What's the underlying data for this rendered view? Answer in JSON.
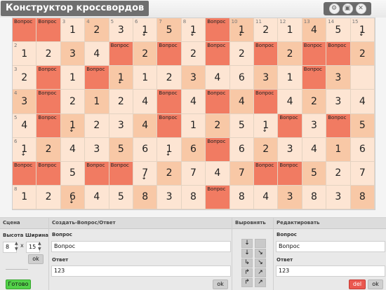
{
  "app": {
    "title": "Конструктор кроссвордов"
  },
  "window_buttons": [
    {
      "icon": "settings-icon"
    },
    {
      "icon": "document-icon"
    },
    {
      "icon": "close-icon"
    }
  ],
  "grid": {
    "rows": [
      [
        "Вопрос",
        "Вопрос",
        "1",
        "2",
        "3",
        "1",
        "5",
        "1",
        "Вопрос",
        "1",
        "2",
        "1",
        "4",
        "5",
        "1"
      ],
      [
        "1",
        "2",
        "3",
        "4",
        "Вопрос",
        "2",
        "Вопрос",
        "2",
        "Вопрос",
        "2",
        "Вопрос",
        "2",
        "Вопрос",
        "Вопрос",
        "2"
      ],
      [
        "2",
        "Вопрос",
        "1",
        "Вопрос",
        "1",
        "1",
        "2",
        "3",
        "4",
        "6",
        "3",
        "1",
        "Вопрос",
        "3",
        ""
      ],
      [
        "3",
        "Вопрос",
        "2",
        "1",
        "2",
        "4",
        "Вопрос",
        "4",
        "Вопрос",
        "4",
        "Вопрос",
        "4",
        "2",
        "3",
        "4"
      ],
      [
        "4",
        "Вопрос",
        "1",
        "2",
        "3",
        "4",
        "Вопрос",
        "1",
        "2",
        "5",
        "1",
        "Вопрос",
        "3",
        "Вопрос",
        "5"
      ],
      [
        "1",
        "2",
        "4",
        "3",
        "5",
        "6",
        "1",
        "6",
        "Вопрос",
        "6",
        "2",
        "3",
        "4",
        "1",
        "6"
      ],
      [
        "Вопрос",
        "Вопрос",
        "5",
        "Вопрос",
        "Вопрос",
        "7",
        "2",
        "7",
        "4",
        "7",
        "Вопрос",
        "Вопрос",
        "5",
        "2",
        "7"
      ],
      [
        "1",
        "2",
        "6",
        "4",
        "5",
        "8",
        "3",
        "8",
        "Вопрос",
        "8",
        "4",
        "3",
        "8",
        "3",
        "8"
      ]
    ],
    "col_numbers": [
      "",
      "",
      "3",
      "4",
      "5",
      "6",
      "7",
      "8",
      "9",
      "10",
      "11",
      "12",
      "13",
      "14",
      "15"
    ],
    "row_numbers": [
      "",
      "2",
      "3",
      "4",
      "5",
      "6",
      "7",
      "8"
    ]
  },
  "panel": {
    "scene": {
      "header": "Сцена",
      "height_label": "Высота",
      "width_label": "Ширина",
      "height_value": "8",
      "width_value": "15",
      "times": "x",
      "ok_label": "ok",
      "done_label": "Готово"
    },
    "create": {
      "header": "Создать-Вопрос/Ответ",
      "question_label": "Вопрос",
      "question_value": "Вопрос",
      "answer_label": "Ответ",
      "answer_value": "123",
      "ok_label": "ok"
    },
    "align": {
      "header": "Выровнять",
      "buttons": [
        "↓",
        "",
        "↓",
        "↘",
        "↳",
        "↘",
        "↱",
        "↗",
        "↱",
        "↗"
      ]
    },
    "edit": {
      "header": "Редактировать",
      "question_label": "Вопрос",
      "question_value": "Вопрос",
      "answer_label": "Ответ",
      "answer_value": "123",
      "del_label": "del",
      "ok_label": "ok"
    }
  },
  "colors": {
    "question_cell": "#f17b62",
    "light_cell": "#fde5d3",
    "mid_cell": "#f8c8a6",
    "done_button": "#53d14a",
    "del_button": "#ea584f"
  }
}
